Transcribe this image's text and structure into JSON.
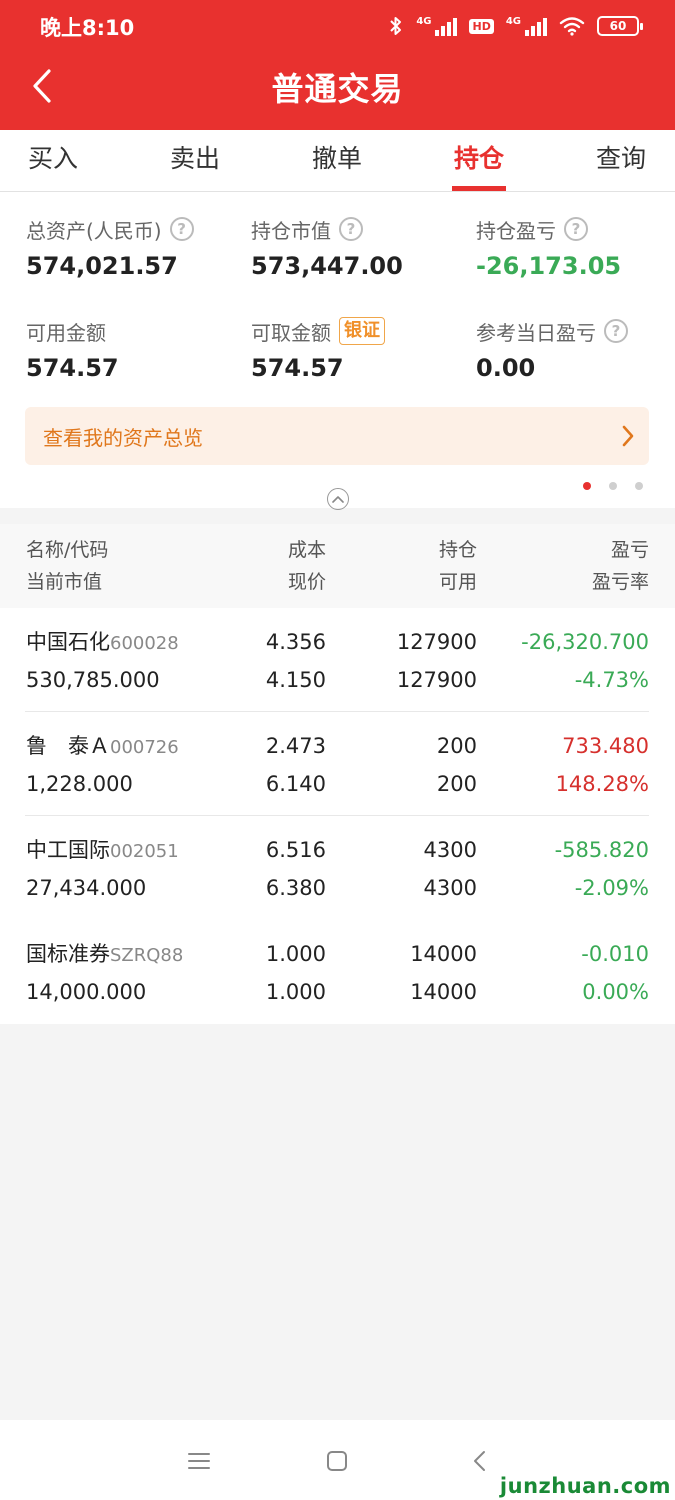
{
  "status_bar": {
    "time": "晚上8:10",
    "sim1_label": "4G",
    "sim2_label": "4G",
    "hd_label": "HD",
    "battery": "60"
  },
  "header": {
    "title": "普通交易"
  },
  "tabs": [
    {
      "label": "买入"
    },
    {
      "label": "卖出"
    },
    {
      "label": "撤单"
    },
    {
      "label": "持仓",
      "active": true
    },
    {
      "label": "查询"
    }
  ],
  "summary": {
    "total_assets_label": "总资产(人民币)",
    "total_assets_value": "574,021.57",
    "market_value_label": "持仓市值",
    "market_value_value": "573,447.00",
    "position_pl_label": "持仓盈亏",
    "position_pl_value": "-26,173.05",
    "available_label": "可用金额",
    "available_value": "574.57",
    "withdrawable_label": "可取金额",
    "withdrawable_badge": "银证",
    "withdrawable_value": "574.57",
    "daily_pl_label": "参考当日盈亏",
    "daily_pl_value": "0.00",
    "help_glyph": "?",
    "asset_overview_link": "查看我的资产总览"
  },
  "table_header": {
    "col1_top": "名称/代码",
    "col1_bottom": "当前市值",
    "col2_top": "成本",
    "col2_bottom": "现价",
    "col3_top": "持仓",
    "col3_bottom": "可用",
    "col4_top": "盈亏",
    "col4_bottom": "盈亏率"
  },
  "holdings": [
    {
      "name": "中国石化",
      "code": "600028",
      "market_value": "530,785.000",
      "cost": "4.356",
      "price": "4.150",
      "position": "127900",
      "available": "127900",
      "pl": "-26,320.700",
      "pl_rate": "-4.73%",
      "trend": "neg"
    },
    {
      "name": "鲁　泰Ａ",
      "code": "000726",
      "market_value": "1,228.000",
      "cost": "2.473",
      "price": "6.140",
      "position": "200",
      "available": "200",
      "pl": "733.480",
      "pl_rate": "148.28%",
      "trend": "pos"
    },
    {
      "name": "中工国际",
      "code": "002051",
      "market_value": "27,434.000",
      "cost": "6.516",
      "price": "6.380",
      "position": "4300",
      "available": "4300",
      "pl": "-585.820",
      "pl_rate": "-2.09%",
      "trend": "neg"
    },
    {
      "name": "国标准券",
      "code": "SZRQ88",
      "market_value": "14,000.000",
      "cost": "1.000",
      "price": "1.000",
      "position": "14000",
      "available": "14000",
      "pl": "-0.010",
      "pl_rate": "0.00%",
      "trend": "neg"
    }
  ],
  "watermark": "junzhuan.com",
  "colors": {
    "brand_red": "#e8312f",
    "profit_red": "#d6302d",
    "loss_green": "#3aaa56",
    "link_orange": "#e0771c"
  }
}
